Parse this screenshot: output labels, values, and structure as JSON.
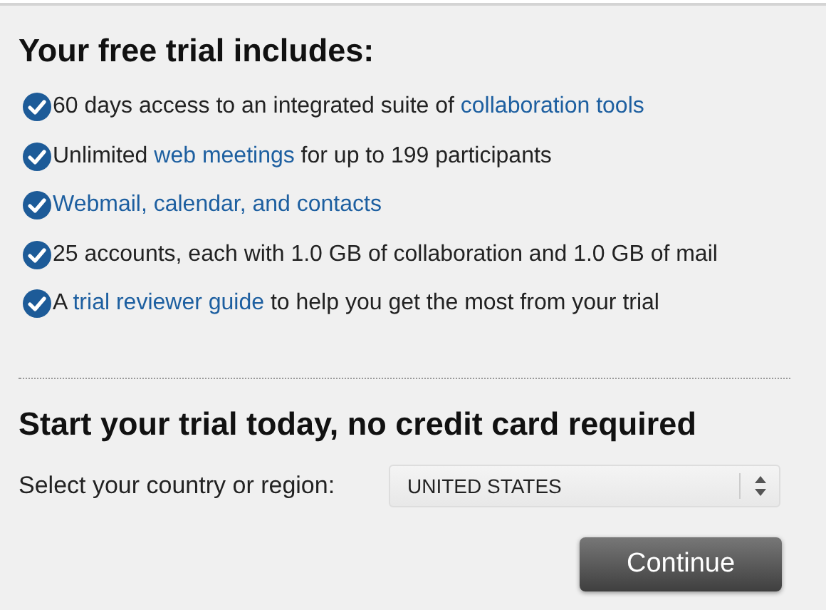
{
  "trial": {
    "heading": "Your free trial includes:",
    "items": [
      {
        "segments": [
          {
            "text": "60 days access to an integrated suite of ",
            "link": false
          },
          {
            "text": "collaboration tools",
            "link": true
          }
        ]
      },
      {
        "segments": [
          {
            "text": "Unlimited ",
            "link": false
          },
          {
            "text": "web meetings",
            "link": true
          },
          {
            "text": " for up to 199 participants",
            "link": false
          }
        ]
      },
      {
        "segments": [
          {
            "text": "Webmail, calendar, and contacts",
            "link": true
          }
        ]
      },
      {
        "segments": [
          {
            "text": "25 accounts, each with 1.0 GB of collaboration and 1.0 GB of mail",
            "link": false
          }
        ]
      },
      {
        "segments": [
          {
            "text": "A ",
            "link": false
          },
          {
            "text": "trial reviewer guide",
            "link": true
          },
          {
            "text": " to help you get the most from your trial",
            "link": false
          }
        ]
      }
    ]
  },
  "start": {
    "heading": "Start your trial today, no credit card required",
    "country_label": "Select your country or region:",
    "country_value": "UNITED STATES",
    "button": "Continue"
  }
}
